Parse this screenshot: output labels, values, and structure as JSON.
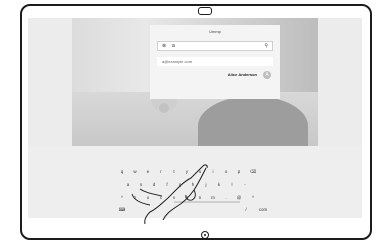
{
  "search": {
    "title": "Ummp",
    "query": "a",
    "search_icon": "search-icon",
    "clear_icon": "clear-icon",
    "suggestion": "a@example.com",
    "contact_name": "Alice Anderson",
    "contact_avatar": "A"
  },
  "keyboard": {
    "row1": [
      "q",
      "w",
      "e",
      "r",
      "t",
      "y",
      "u",
      "i",
      "o",
      "p",
      "⌫"
    ],
    "row2": [
      "a",
      "s",
      "d",
      "f",
      "g",
      "h",
      "j",
      "k",
      "l",
      "-"
    ],
    "row3": [
      "^",
      "z",
      "x",
      "c",
      "v",
      "b",
      "n",
      "m",
      ".",
      "@",
      "^"
    ],
    "row4": [
      "⌨",
      "/",
      "com"
    ]
  },
  "colors": {
    "frame": "#1c1c1c",
    "screen": "#ececec"
  }
}
